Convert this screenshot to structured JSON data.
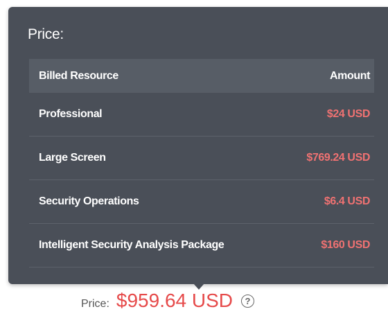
{
  "popover": {
    "title": "Price:",
    "columns": {
      "resource": "Billed Resource",
      "amount": "Amount"
    },
    "rows": [
      {
        "resource": "Professional",
        "amount": "$24 USD"
      },
      {
        "resource": "Large Screen",
        "amount": "$769.24 USD"
      },
      {
        "resource": "Security Operations",
        "amount": "$6.4 USD"
      },
      {
        "resource": "Intelligent Security Analysis Package",
        "amount": "$160 USD"
      }
    ]
  },
  "summary": {
    "label": "Price:",
    "total": "$959.64 USD",
    "help_icon": "question-circle-icon"
  },
  "colors": {
    "popover_bg": "#4a4f58",
    "amount_red": "#f07272",
    "total_red": "#e64a4a"
  }
}
